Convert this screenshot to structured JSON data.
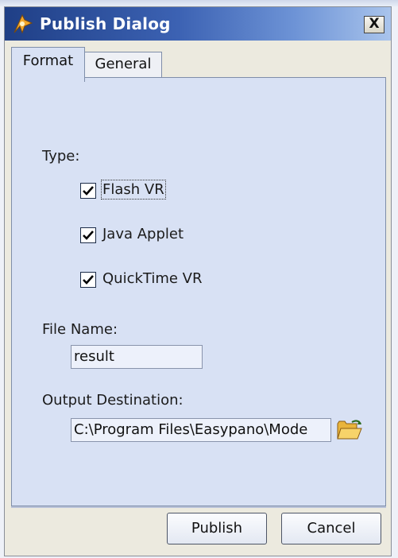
{
  "window": {
    "title": "Publish Dialog",
    "close_label": "X"
  },
  "tabs": [
    {
      "label": "Format",
      "active": true
    },
    {
      "label": "General",
      "active": false
    }
  ],
  "format": {
    "type_label": "Type:",
    "options": [
      {
        "label": "Flash VR",
        "checked": true
      },
      {
        "label": "Java Applet",
        "checked": true
      },
      {
        "label": "QuickTime VR",
        "checked": true
      }
    ],
    "file_name_label": "File Name:",
    "file_name_value": "result",
    "output_label": "Output Destination:",
    "output_value": "C:\\Program Files\\Easypano\\Mode"
  },
  "buttons": {
    "publish": "Publish",
    "cancel": "Cancel"
  },
  "icons": {
    "app": "tourweaver-app-icon",
    "browse": "open-folder-icon",
    "checkbox": "checkmark-icon"
  },
  "colors": {
    "titlebar_start": "#1f3f86",
    "titlebar_end": "#a9c4ec",
    "panel": "#d8e1f4"
  }
}
